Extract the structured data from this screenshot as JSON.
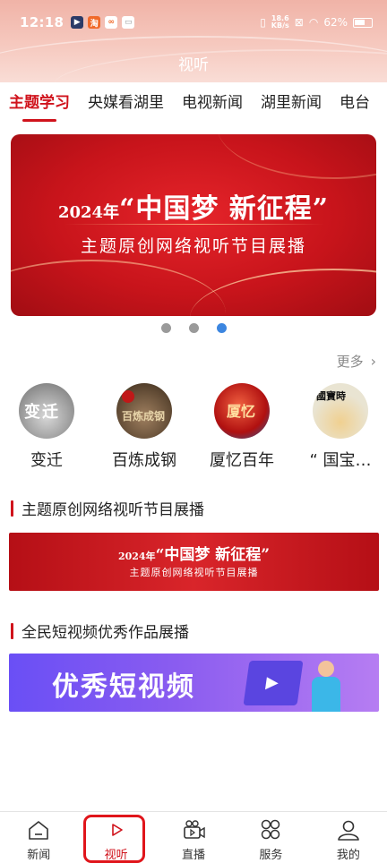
{
  "status_bar": {
    "time": "12:18",
    "net_speed_top": "18.6",
    "net_speed_bottom": "KB/s",
    "battery": "62%"
  },
  "header": {
    "title": "视听"
  },
  "tabs": [
    {
      "label": "主题学习",
      "active": true
    },
    {
      "label": "央媒看湖里",
      "active": false
    },
    {
      "label": "电视新闻",
      "active": false
    },
    {
      "label": "湖里新闻",
      "active": false
    },
    {
      "label": "电台",
      "active": false
    }
  ],
  "banner": {
    "year": "2024年",
    "headline": "“中国梦 新征程”",
    "subtitle": "主题原创网络视听节目展播",
    "page_count": 3,
    "active_page": 3
  },
  "more_label": "更多",
  "programs": [
    {
      "name": "变迁"
    },
    {
      "name": "百炼成钢"
    },
    {
      "name": "厦忆百年"
    },
    {
      "name": "“ 国宝…"
    }
  ],
  "sections": [
    {
      "title": "主题原创网络视听节目展播",
      "banner_year": "2024年",
      "banner_headline": "“中国梦 新征程”",
      "banner_subtitle": "主题原创网络视听节目展播"
    },
    {
      "title": "全民短视频优秀作品展播",
      "banner_text": "优秀短视频"
    }
  ],
  "bottom_nav": [
    {
      "label": "新闻",
      "icon": "home-icon",
      "active": false
    },
    {
      "label": "视听",
      "icon": "play-icon",
      "active": true
    },
    {
      "label": "直播",
      "icon": "live-camera-icon",
      "active": false
    },
    {
      "label": "服务",
      "icon": "grid-icon",
      "active": false
    },
    {
      "label": "我的",
      "icon": "user-icon",
      "active": false
    }
  ],
  "colors": {
    "accent": "#d0131c",
    "header_bg": "#f0b3a7",
    "dot_active": "#3c86e0"
  }
}
